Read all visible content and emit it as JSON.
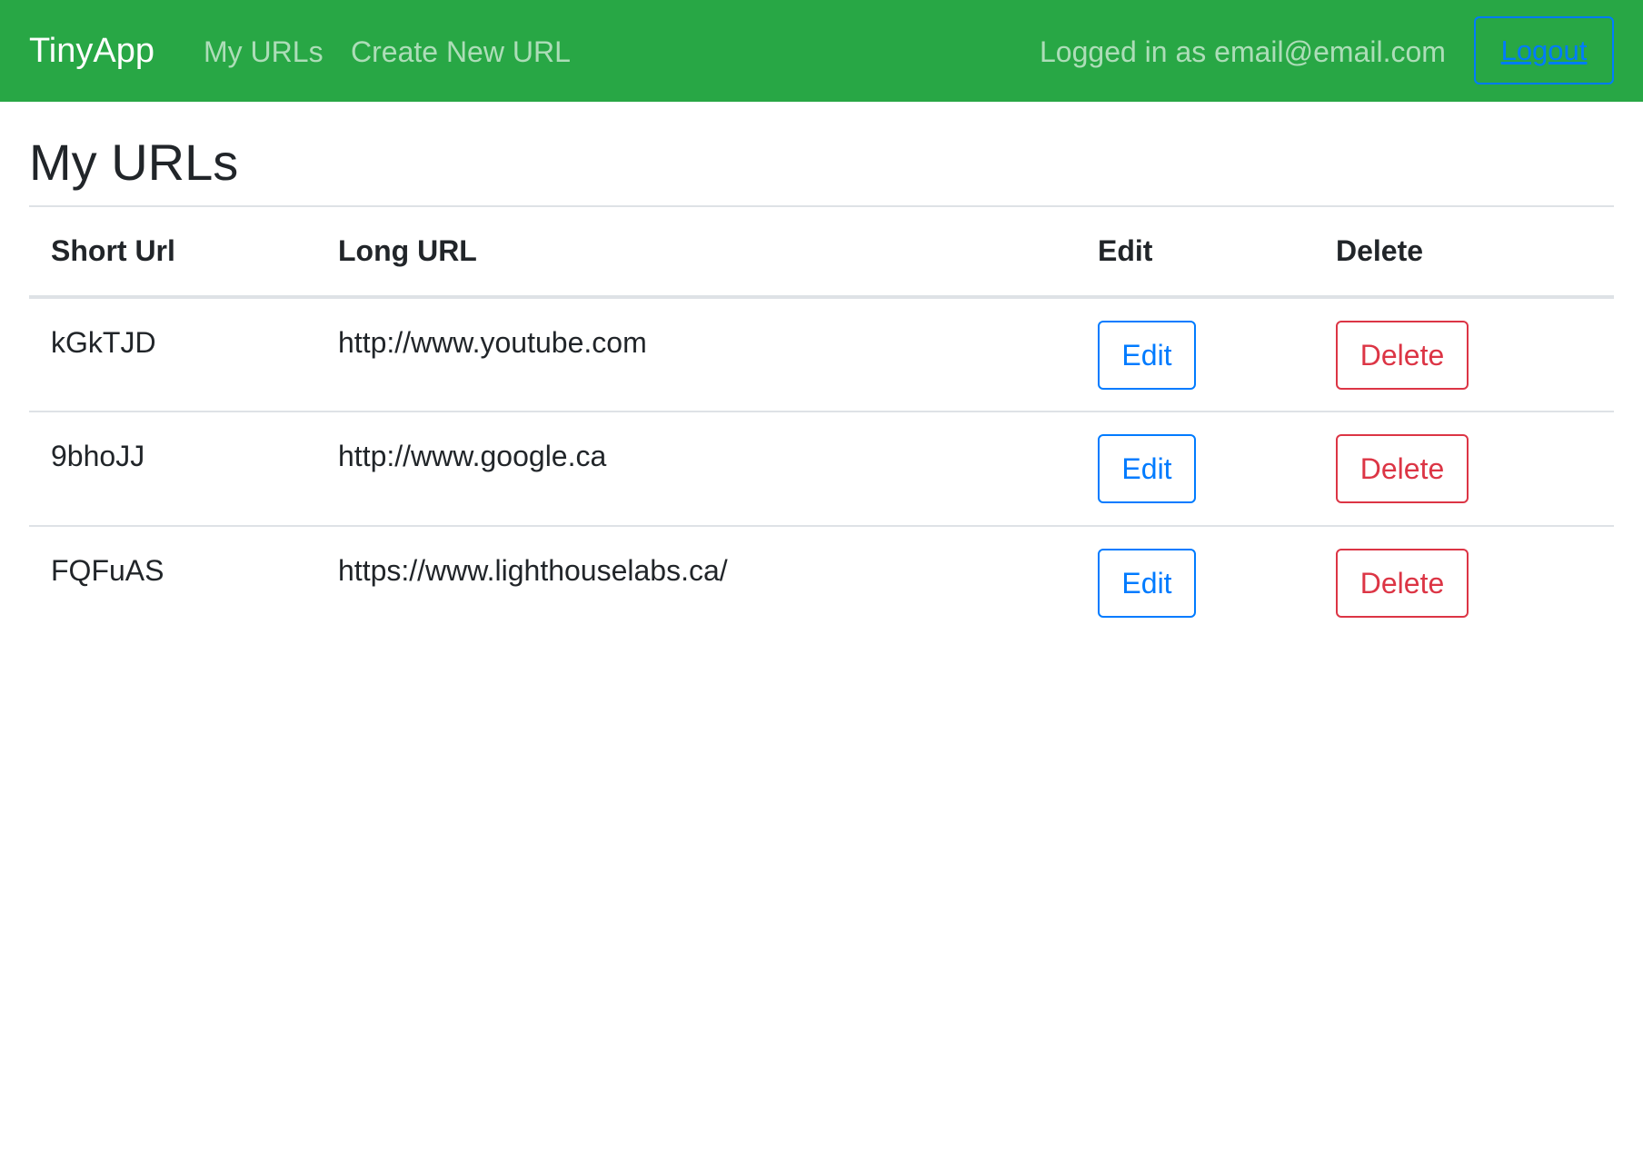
{
  "navbar": {
    "brand": "TinyApp",
    "links": {
      "my_urls": "My URLs",
      "create_new": "Create New URL"
    },
    "logged_in_text": "Logged in as email@email.com",
    "logout_label": "Logout"
  },
  "page": {
    "title": "My URLs"
  },
  "table": {
    "headers": {
      "short": "Short Url",
      "long": "Long URL",
      "edit": "Edit",
      "delete": "Delete"
    },
    "rows": [
      {
        "short": "kGkTJD",
        "long": "http://www.youtube.com",
        "edit_label": "Edit",
        "delete_label": "Delete"
      },
      {
        "short": "9bhoJJ",
        "long": "http://www.google.ca",
        "edit_label": "Edit",
        "delete_label": "Delete"
      },
      {
        "short": "FQFuAS",
        "long": "https://www.lighthouselabs.ca/",
        "edit_label": "Edit",
        "delete_label": "Delete"
      }
    ]
  },
  "colors": {
    "navbar_bg": "#28a745",
    "primary": "#007bff",
    "danger": "#dc3545"
  }
}
